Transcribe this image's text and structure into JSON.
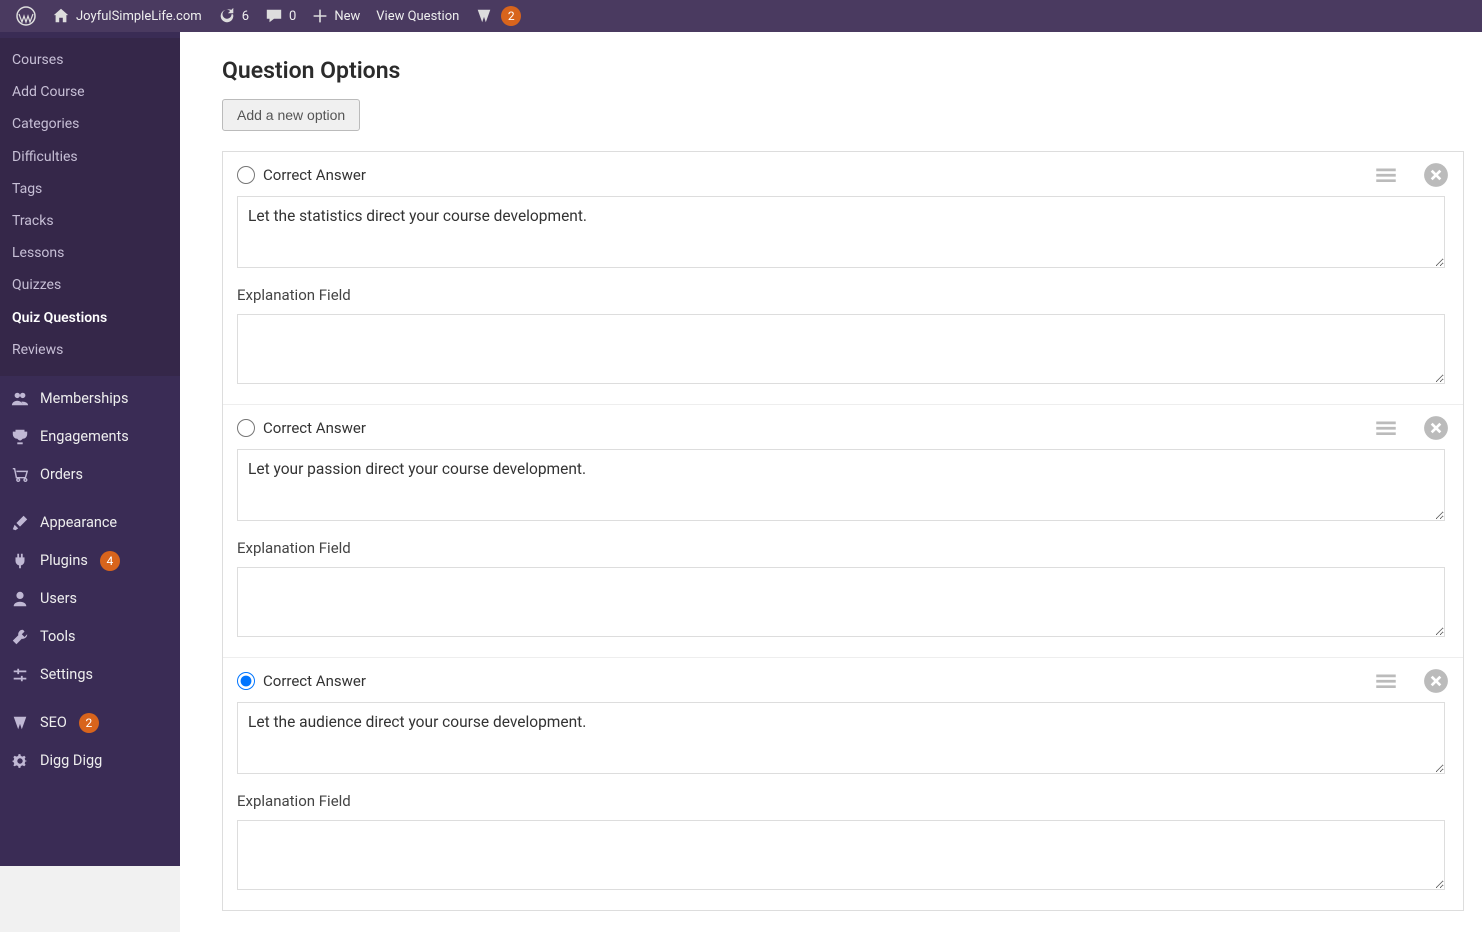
{
  "adminbar": {
    "site_name": "JoyfulSimpleLife.com",
    "updates_count": "6",
    "comments_count": "0",
    "new_label": "New",
    "view_label": "View Question",
    "yoast_badge": "2"
  },
  "sidebar": {
    "sub": [
      {
        "label": "Courses",
        "active": false
      },
      {
        "label": "Add Course",
        "active": false
      },
      {
        "label": "Categories",
        "active": false
      },
      {
        "label": "Difficulties",
        "active": false
      },
      {
        "label": "Tags",
        "active": false
      },
      {
        "label": "Tracks",
        "active": false
      },
      {
        "label": "Lessons",
        "active": false
      },
      {
        "label": "Quizzes",
        "active": false
      },
      {
        "label": "Quiz Questions",
        "active": true
      },
      {
        "label": "Reviews",
        "active": false
      }
    ],
    "items": [
      {
        "label": "Memberships",
        "icon": "users-icon",
        "badge": null
      },
      {
        "label": "Engagements",
        "icon": "trophy-icon",
        "badge": null
      },
      {
        "label": "Orders",
        "icon": "cart-icon",
        "badge": null
      },
      {
        "sep": true
      },
      {
        "label": "Appearance",
        "icon": "brush-icon",
        "badge": null
      },
      {
        "label": "Plugins",
        "icon": "plug-icon",
        "badge": "4"
      },
      {
        "label": "Users",
        "icon": "user-icon",
        "badge": null
      },
      {
        "label": "Tools",
        "icon": "wrench-icon",
        "badge": null
      },
      {
        "label": "Settings",
        "icon": "sliders-icon",
        "badge": null
      },
      {
        "sep": true
      },
      {
        "label": "SEO",
        "icon": "yoast-icon",
        "badge": "2"
      },
      {
        "label": "Digg Digg",
        "icon": "gear-icon",
        "badge": null
      }
    ]
  },
  "main": {
    "heading": "Question Options",
    "add_option_label": "Add a new option",
    "correct_answer_label": "Correct Answer",
    "explanation_label": "Explanation Field",
    "options": [
      {
        "checked": false,
        "text": "Let the statistics direct your course development.",
        "explanation": ""
      },
      {
        "checked": false,
        "text": "Let your passion direct your course development.",
        "explanation": ""
      },
      {
        "checked": true,
        "text": "Let the audience direct your course development.",
        "explanation": ""
      }
    ]
  }
}
